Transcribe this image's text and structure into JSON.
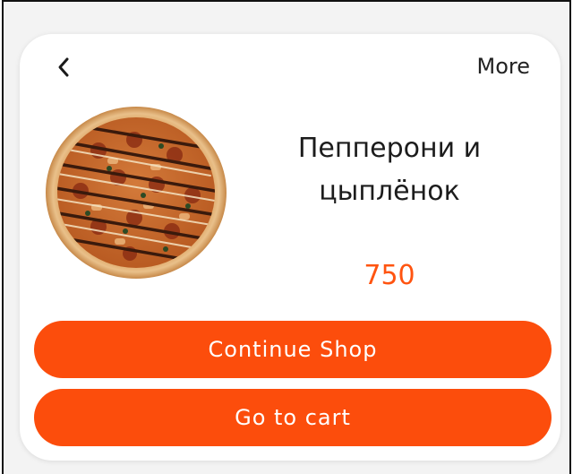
{
  "header": {
    "back_icon": "chevron-left-icon",
    "more_label": "More"
  },
  "product": {
    "image_icon": "pizza-image",
    "name": "Пепперони и цыплёнок",
    "price": "750"
  },
  "actions": {
    "continue_label": "Continue Shop",
    "cart_label": "Go to cart"
  },
  "colors": {
    "accent": "#fc4d0c",
    "price": "#ff5410",
    "text": "#1c1c1c"
  }
}
